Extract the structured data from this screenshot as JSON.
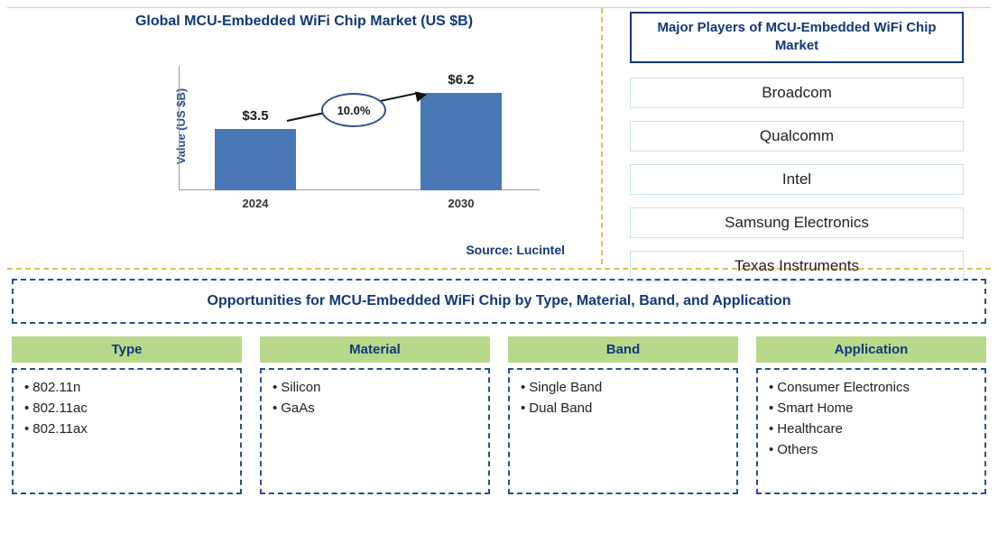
{
  "chart_data": {
    "type": "bar",
    "title": "Global MCU-Embedded WiFi Chip Market (US $B)",
    "ylabel": "Value (US $B)",
    "xlabel": "",
    "categories": [
      "2024",
      "2030"
    ],
    "values": [
      3.5,
      6.2
    ],
    "data_labels": [
      "$3.5",
      "$6.2"
    ],
    "growth_rate": "10.0%",
    "ylim": [
      0,
      7
    ],
    "source": "Source: Lucintel"
  },
  "players": {
    "title": "Major Players of MCU-Embedded WiFi Chip Market",
    "list": [
      "Broadcom",
      "Qualcomm",
      "Intel",
      "Samsung Electronics",
      "Texas Instruments"
    ]
  },
  "opportunities": {
    "title": "Opportunities for MCU-Embedded WiFi Chip by Type, Material, Band, and Application",
    "columns": [
      {
        "header": "Type",
        "items": [
          "802.11n",
          "802.11ac",
          "802.11ax"
        ]
      },
      {
        "header": "Material",
        "items": [
          "Silicon",
          "GaAs"
        ]
      },
      {
        "header": "Band",
        "items": [
          "Single Band",
          "Dual Band"
        ]
      },
      {
        "header": "Application",
        "items": [
          "Consumer Electronics",
          "Smart Home",
          "Healthcare",
          "Others"
        ]
      }
    ]
  }
}
